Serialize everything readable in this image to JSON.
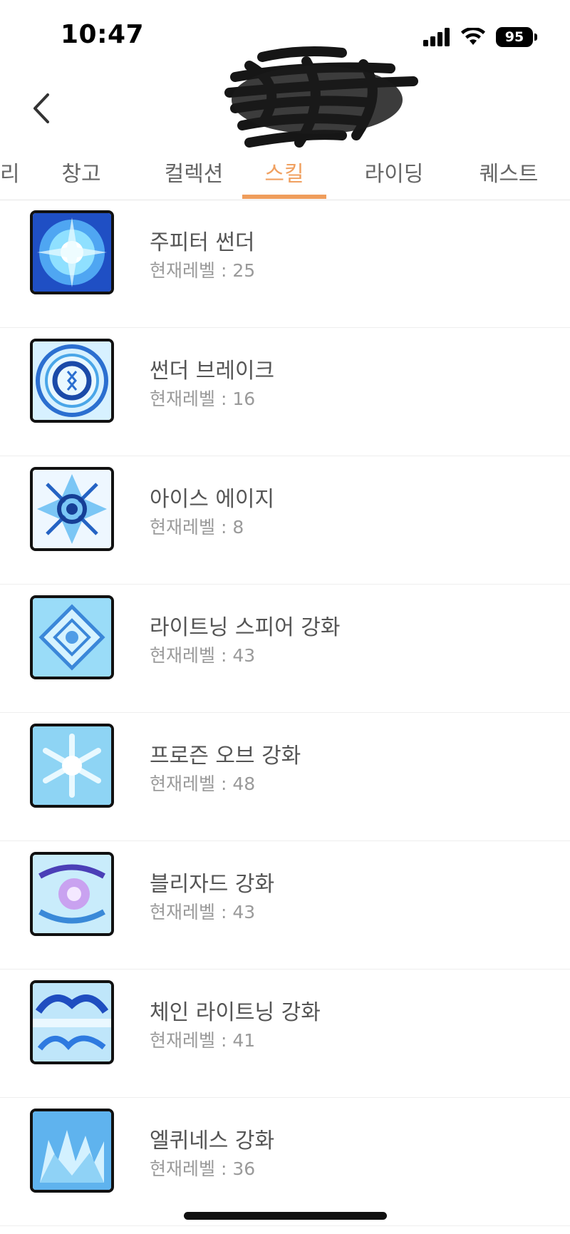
{
  "status_bar": {
    "time": "10:47",
    "battery": "95",
    "icons": [
      "signal-icon",
      "wifi-icon",
      "battery-icon"
    ]
  },
  "header": {
    "back_icon": "chevron-left-icon"
  },
  "tabs": [
    {
      "label": "리",
      "active": false
    },
    {
      "label": "창고",
      "active": false
    },
    {
      "label": "컬렉션",
      "active": false
    },
    {
      "label": "스킬",
      "active": true
    },
    {
      "label": "라이딩",
      "active": false
    },
    {
      "label": "퀘스트",
      "active": false
    }
  ],
  "skills": [
    {
      "name": "주피터 썬더",
      "level": "현재레벨 : 25"
    },
    {
      "name": "썬더 브레이크",
      "level": "현재레벨 : 16"
    },
    {
      "name": "아이스 에이지",
      "level": "현재레벨 : 8"
    },
    {
      "name": "라이트닝 스피어 강화",
      "level": "현재레벨 : 43"
    },
    {
      "name": "프로즌 오브 강화",
      "level": "현재레벨 : 48"
    },
    {
      "name": "블리자드 강화",
      "level": "현재레벨 : 43"
    },
    {
      "name": "체인 라이트닝 강화",
      "level": "현재레벨 : 41"
    },
    {
      "name": "엘퀴네스 강화",
      "level": "현재레벨 : 36"
    }
  ],
  "colors": {
    "accent": "#ef9d5c",
    "text": "#555555",
    "subtext": "#9a9a9a"
  }
}
